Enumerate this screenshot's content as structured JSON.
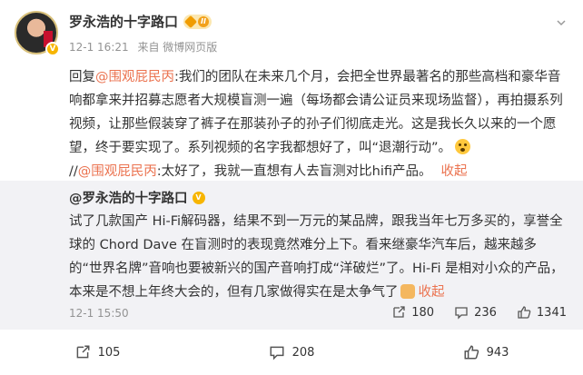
{
  "post": {
    "author": "罗永浩的十字路口",
    "member_level": "II",
    "verified_badge": "V",
    "time": "12-1 16:21",
    "source": "来自 微博网页版",
    "text": {
      "prefix": "回复",
      "mention1": "@围观屁民丙",
      "body1": ":我们的团队在未来几个月，会把全世界最著名的那些高档和豪华音响都拿来并招募志愿者大规模盲测一遍（每场都会请公证员来现场监督），再拍摄系列视频，让那些假装穿了裤子在那装孙子的孙子们彻底走光。这是我长久以来的一个愿望，终于要实现了。系列视频的名字我都想好了，叫“退潮行动”。",
      "separator": "//",
      "mention2": "@围观屁民丙",
      "body2": ":太好了，我就一直想有人去盲测对比hifi产品。",
      "collapse": "收起"
    }
  },
  "repost": {
    "author": "@罗永浩的十字路口",
    "verified_badge": "V",
    "text": "试了几款国产 Hi-Fi解码器，结果不到一万元的某品牌，跟我当年七万多买的，享誉全球的 Chord Dave 在盲测时的表现竟然难分上下。看来继豪华汽车后，越来越多的“世界名牌”音响也要被新兴的国产音响打成“洋破烂”了。Hi-Fi 是相对小众的产品，本来是不想上年终大会的，但有几家做得实在是太争气了",
    "collapse": "收起",
    "time": "12-1 15:50",
    "shares": "180",
    "comments": "236",
    "likes": "1341"
  },
  "footer": {
    "shares": "105",
    "comments": "208",
    "likes": "943"
  },
  "colors": {
    "accent": "#eb7350",
    "repost_bg": "#f2f2f5",
    "meta_text": "#939393"
  },
  "icons": [
    "share-icon",
    "comment-icon",
    "like-icon",
    "chevron-down-icon",
    "verified-icon",
    "member-badge-icon"
  ]
}
